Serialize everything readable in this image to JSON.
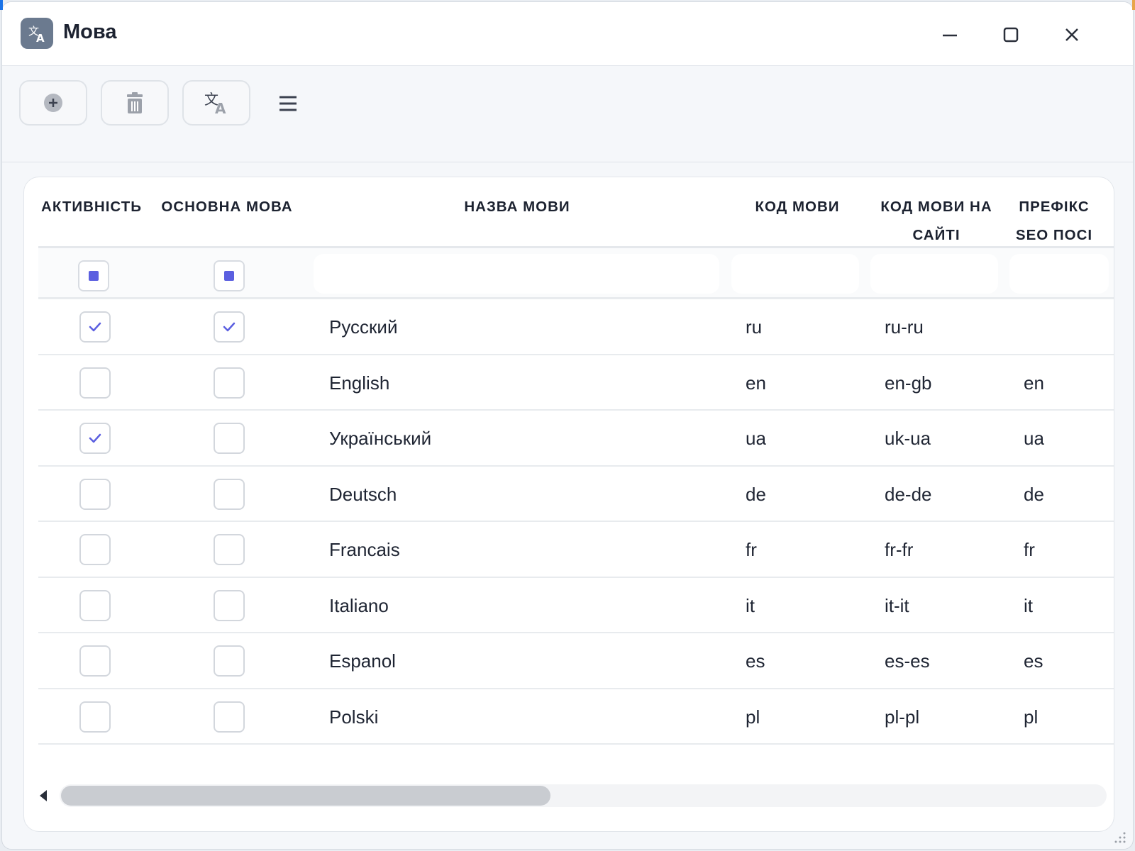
{
  "window": {
    "title": "Мова",
    "app_icon": "translate-icon",
    "controls": [
      "minimize-icon",
      "maximize-icon",
      "close-icon"
    ]
  },
  "toolbar": {
    "buttons": [
      {
        "name": "add-button",
        "icon": "plus-circle-icon"
      },
      {
        "name": "delete-button",
        "icon": "trash-icon"
      },
      {
        "name": "translate-button",
        "icon": "translate-icon"
      }
    ],
    "menu_icon": "hamburger-menu-icon"
  },
  "table": {
    "headers": {
      "active": "АКТИВНІСТЬ",
      "main_language": "ОСНОВНА МОВА",
      "name": "НАЗВА МОВИ",
      "code": "КОД МОВИ",
      "site_code_line1": "КОД МОВИ НА",
      "site_code_line2": "САЙТІ",
      "seo_line1": "ПРЕФІКС",
      "seo_line2": "SEO ПОСІ"
    },
    "filters": {
      "active": "indeterminate",
      "main_language": "indeterminate",
      "name": "",
      "code": "",
      "site_code": "",
      "seo": ""
    },
    "rows": [
      {
        "active": true,
        "main": true,
        "name": "Русский",
        "code": "ru",
        "site_code": "ru-ru",
        "seo": ""
      },
      {
        "active": false,
        "main": false,
        "name": "English",
        "code": "en",
        "site_code": "en-gb",
        "seo": "en"
      },
      {
        "active": true,
        "main": false,
        "name": "Український",
        "code": "ua",
        "site_code": "uk-ua",
        "seo": "ua"
      },
      {
        "active": false,
        "main": false,
        "name": "Deutsch",
        "code": "de",
        "site_code": "de-de",
        "seo": "de"
      },
      {
        "active": false,
        "main": false,
        "name": "Francais",
        "code": "fr",
        "site_code": "fr-fr",
        "seo": "fr"
      },
      {
        "active": false,
        "main": false,
        "name": "Italiano",
        "code": "it",
        "site_code": "it-it",
        "seo": "it"
      },
      {
        "active": false,
        "main": false,
        "name": "Espanol",
        "code": "es",
        "site_code": "es-es",
        "seo": "es"
      },
      {
        "active": false,
        "main": false,
        "name": "Polski",
        "code": "pl",
        "site_code": "pl-pl",
        "seo": "pl"
      }
    ]
  },
  "colors": {
    "accent": "#5b5fe0",
    "border": "#d3d7dd",
    "text": "#1f2533"
  }
}
